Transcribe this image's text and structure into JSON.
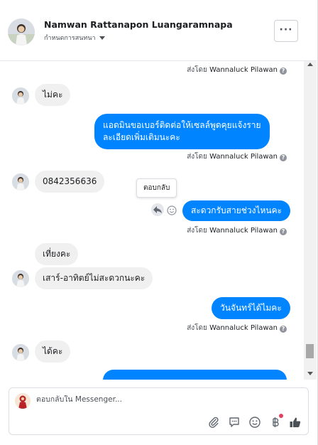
{
  "header": {
    "name": "Namwan Rattanapon Luangaramnapa",
    "subtitle": "กำหนดการสนทนา",
    "more_label": "···"
  },
  "messages": [
    {
      "kind": "sent_by",
      "prefix": "ส่งโดย",
      "author": "Wannaluck Pilawan"
    },
    {
      "kind": "in",
      "text": "ไม่คะ"
    },
    {
      "kind": "out",
      "lines": [
        "แอดมินขอเบอร์ติดต่อให้เซลล์พูดคุยแจ้งราย",
        "ละเอียดเพิ่มเติมนะคะ"
      ]
    },
    {
      "kind": "sent_by",
      "prefix": "ส่งโดย",
      "author": "Wannaluck Pilawan"
    },
    {
      "kind": "in",
      "text": "0842356636"
    },
    {
      "kind": "out",
      "text": "สะดวกรับสายช่วงไหนคะ"
    },
    {
      "kind": "sent_by",
      "prefix": "ส่งโดย",
      "author": "Wannaluck Pilawan"
    },
    {
      "kind": "in",
      "text": "เที่ยงคะ"
    },
    {
      "kind": "in",
      "text": "เสาร์-อาทิตย์ไม่สะดวกนะคะ"
    },
    {
      "kind": "out",
      "text": "วันจันทร์ได้ไมคะ"
    },
    {
      "kind": "sent_by",
      "prefix": "ส่งโดย",
      "author": "Wannaluck Pilawan"
    },
    {
      "kind": "in",
      "text": "ได้คะ"
    }
  ],
  "tooltip": "ตอบกลับ",
  "composer": {
    "placeholder": "ตอบกลับใน Messenger..."
  },
  "icons": {
    "attach": "paperclip-icon",
    "sticker": "chat-bubble-icon",
    "emoji": "smiley-icon",
    "payment": "baht-icon",
    "like": "thumbs-up-icon"
  },
  "colors": {
    "outgoing_bubble": "#0084ff",
    "incoming_bubble": "#f1f0f0",
    "notification_dot": "#e4405f"
  }
}
